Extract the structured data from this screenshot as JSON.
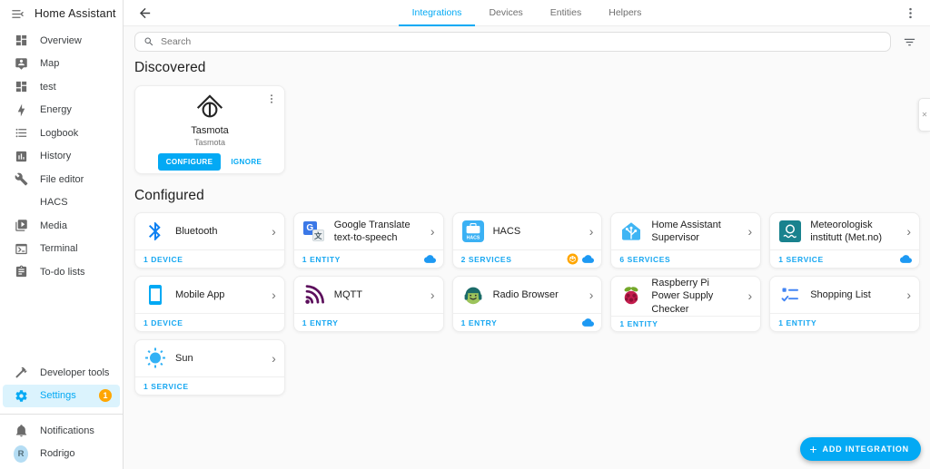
{
  "app": {
    "title": "Home Assistant"
  },
  "colors": {
    "accent": "#03a9f4",
    "badge_orange": "#ffa600",
    "content_bg": "#fafafa",
    "stat_blue": "#17a7f1"
  },
  "sidebar": {
    "items": [
      {
        "label": "Overview",
        "icon": "dashboard-icon"
      },
      {
        "label": "Map",
        "icon": "map-icon"
      },
      {
        "label": "test",
        "icon": "dashboard-icon"
      },
      {
        "label": "Energy",
        "icon": "lightning-icon"
      },
      {
        "label": "Logbook",
        "icon": "list-icon"
      },
      {
        "label": "History",
        "icon": "chart-box-icon"
      },
      {
        "label": "File editor",
        "icon": "wrench-icon"
      },
      {
        "label": "HACS",
        "icon": "none"
      },
      {
        "label": "Media",
        "icon": "media-play-icon"
      },
      {
        "label": "Terminal",
        "icon": "terminal-icon"
      },
      {
        "label": "To-do lists",
        "icon": "clipboard-icon"
      }
    ],
    "bottom_items": [
      {
        "label": "Developer tools",
        "icon": "hammer-icon",
        "active": false
      },
      {
        "label": "Settings",
        "icon": "gear-icon",
        "active": true,
        "badge": "1"
      }
    ],
    "footer_items": [
      {
        "label": "Notifications",
        "icon": "bell-icon"
      },
      {
        "label": "Rodrigo",
        "icon": "avatar",
        "avatar_letter": "R"
      }
    ]
  },
  "header": {
    "tabs": [
      {
        "label": "Integrations",
        "active": true
      },
      {
        "label": "Devices",
        "active": false
      },
      {
        "label": "Entities",
        "active": false
      },
      {
        "label": "Helpers",
        "active": false
      }
    ]
  },
  "search": {
    "placeholder": "Search"
  },
  "sections": {
    "discovered_title": "Discovered",
    "configured_title": "Configured"
  },
  "discovered": [
    {
      "name": "Tasmota",
      "subtitle": "Tasmota",
      "icon": "tasmota-icon",
      "configure_label": "CONFIGURE",
      "ignore_label": "IGNORE"
    }
  ],
  "configured": [
    {
      "name": "Bluetooth",
      "icon": "bluetooth-icon",
      "footer": "1 DEVICE",
      "badges": []
    },
    {
      "name": "Google Translate text-to-speech",
      "icon": "google-translate-icon",
      "footer": "1 ENTITY",
      "badges": [
        "cloud"
      ]
    },
    {
      "name": "HACS",
      "icon": "hacs-icon",
      "footer": "2 SERVICES",
      "badges": [
        "custom-integration",
        "cloud"
      ]
    },
    {
      "name": "Home Assistant Supervisor",
      "icon": "ha-supervisor-icon",
      "footer": "6 SERVICES",
      "badges": []
    },
    {
      "name": "Meteorologisk institutt (Met.no)",
      "icon": "metno-icon",
      "footer": "1 SERVICE",
      "badges": [
        "cloud"
      ]
    },
    {
      "name": "Mobile App",
      "icon": "mobile-app-icon",
      "footer": "1 DEVICE",
      "badges": []
    },
    {
      "name": "MQTT",
      "icon": "mqtt-icon",
      "footer": "1 ENTRY",
      "badges": []
    },
    {
      "name": "Radio Browser",
      "icon": "radio-browser-icon",
      "footer": "1 ENTRY",
      "badges": [
        "cloud"
      ]
    },
    {
      "name": "Raspberry Pi Power Supply Checker",
      "icon": "raspberry-pi-icon",
      "footer": "1 ENTITY",
      "badges": []
    },
    {
      "name": "Shopping List",
      "icon": "shopping-list-icon",
      "footer": "1 ENTITY",
      "badges": []
    },
    {
      "name": "Sun",
      "icon": "sun-icon",
      "footer": "1 SERVICE",
      "badges": []
    }
  ],
  "fab": {
    "label": "ADD INTEGRATION"
  }
}
